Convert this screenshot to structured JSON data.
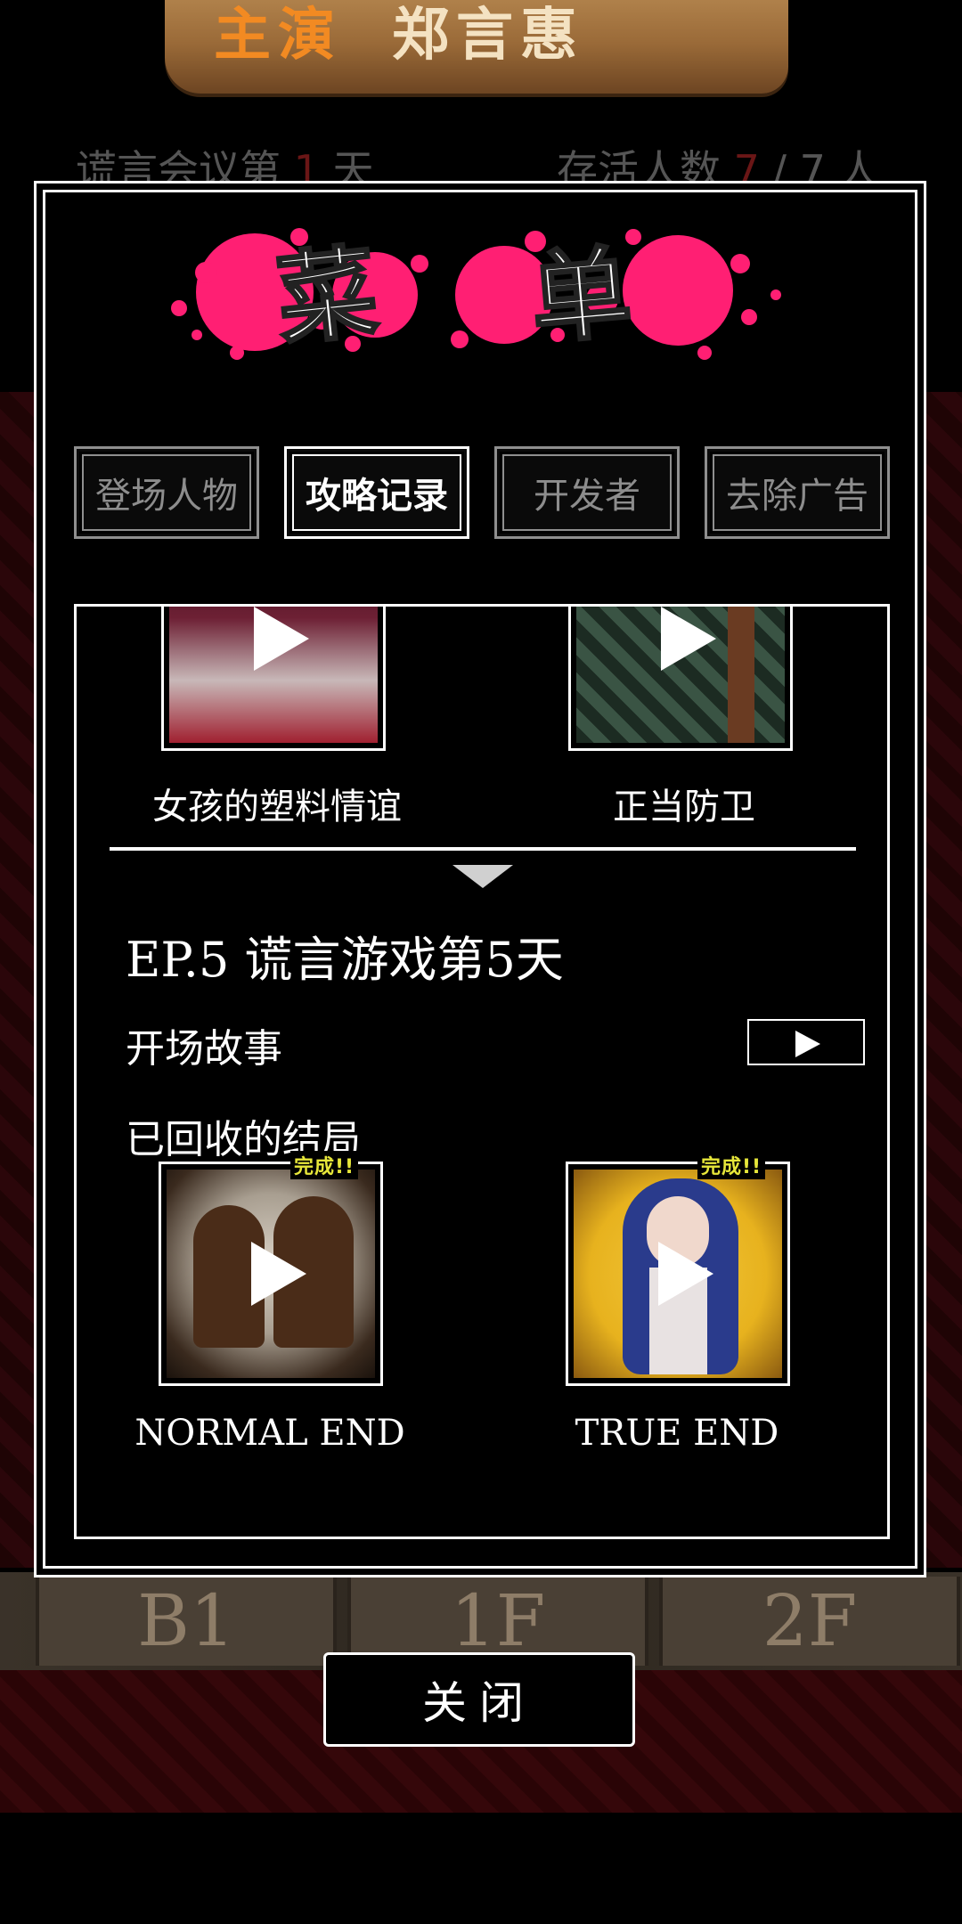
{
  "background": {
    "banner_left": "主演",
    "banner_right": "郑言惠",
    "days_label": "谎言会议第",
    "days_value": "1",
    "days_unit": "天",
    "alive_label": "存活人数",
    "alive_value": "7",
    "alive_total": "/ 7 人",
    "floors": [
      "B1",
      "1F",
      "2F"
    ]
  },
  "menu": {
    "title_chars": [
      "菜",
      "单"
    ],
    "tabs": [
      {
        "label": "登场人物",
        "active": false
      },
      {
        "label": "攻略记录",
        "active": true
      },
      {
        "label": "开发者",
        "active": false
      },
      {
        "label": "去除广告",
        "active": false
      }
    ],
    "previous_endings": [
      {
        "caption": "女孩的塑料情谊",
        "art": "girl-plastic-friendship"
      },
      {
        "caption": "正当防卫",
        "art": "self-defense"
      }
    ],
    "episode": {
      "title": "EP.5  谎言游戏第5天",
      "opening_label": "开场故事",
      "collected_label": "已回收的结局",
      "endings": [
        {
          "caption": "NORMAL END",
          "badge": "完成!!",
          "art": "two-silhouettes"
        },
        {
          "caption": "TRUE END",
          "badge": "完成!!",
          "art": "blue-haired-girl"
        }
      ]
    },
    "close_label": "关闭"
  },
  "colors": {
    "splat": "#ff1f73",
    "badge": "#e6e63a",
    "true_end_bg": "#e7b21e"
  }
}
